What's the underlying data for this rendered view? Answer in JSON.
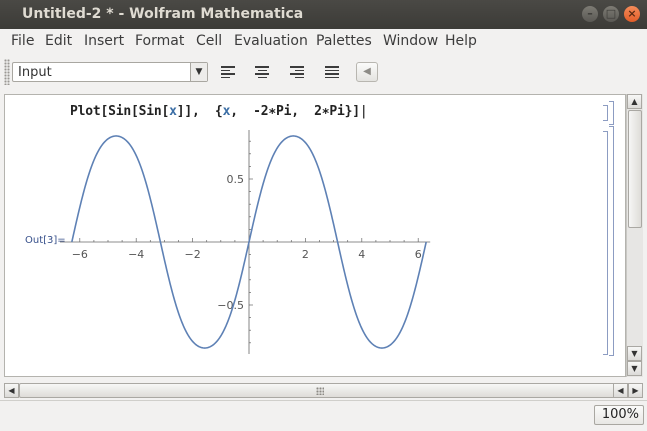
{
  "window": {
    "title": "Untitled-2 * - Wolfram Mathematica",
    "minimize_glyph": "–",
    "maximize_glyph": "□",
    "close_glyph": "×"
  },
  "menu": [
    "File",
    "Edit",
    "Insert",
    "Format",
    "Cell",
    "Evaluation",
    "Palettes",
    "Window",
    "Help"
  ],
  "toolbar": {
    "style_value": "Input",
    "dropdown_glyph": "▼",
    "back_glyph": "◀"
  },
  "cell": {
    "input_parts": [
      "Plot[Sin[Sin[",
      "x",
      "]],  {",
      "x",
      ",  -2",
      "∗",
      "Pi,  2",
      "∗",
      "Pi}]"
    ],
    "output_label": "Out[3]="
  },
  "scroll": {
    "up": "▲",
    "down": "▼",
    "left": "◀",
    "right": "▶"
  },
  "status": {
    "zoom": "100%"
  },
  "chart_data": {
    "type": "line",
    "function": "Sin[Sin[x]]",
    "xlim": [
      -6.283,
      6.283
    ],
    "ylim": [
      -0.841,
      0.841
    ],
    "x_ticks": [
      -6,
      -4,
      -2,
      2,
      4,
      6
    ],
    "x_tick_labels": [
      "−6",
      "−4",
      "−2",
      "2",
      "4",
      "6"
    ],
    "y_ticks": [
      0.5,
      -0.5
    ],
    "y_tick_labels": [
      "0.5",
      "−0.5"
    ],
    "line_color": "#5e81b5"
  }
}
